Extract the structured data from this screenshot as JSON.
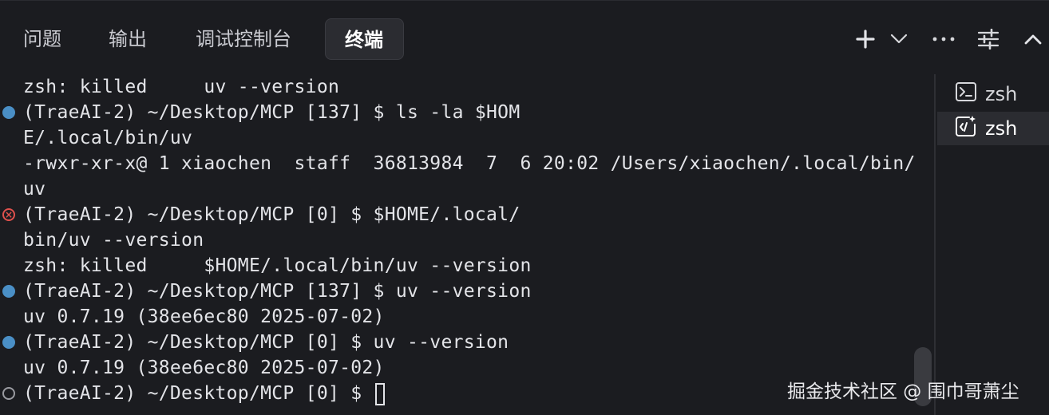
{
  "tabs": [
    {
      "label": "问题"
    },
    {
      "label": "输出"
    },
    {
      "label": "调试控制台"
    },
    {
      "label": "终端",
      "active": true
    }
  ],
  "toolbar": {
    "icons": [
      "plus-icon",
      "chevron-down-icon",
      "more-icon",
      "sliders-icon",
      "chevron-up-icon"
    ]
  },
  "terminal": {
    "lines": [
      {
        "text": "zsh: killed     uv --version",
        "marker": ""
      },
      {
        "text": "(TraeAI-2) ~/Desktop/MCP [137] $ ls -la $HOM",
        "marker": "ok"
      },
      {
        "text": "E/.local/bin/uv",
        "marker": ""
      },
      {
        "text": "-rwxr-xr-x@ 1 xiaochen  staff  36813984  7  6 20:02 /Users/xiaochen/.local/bin/",
        "marker": ""
      },
      {
        "text": "uv",
        "marker": ""
      },
      {
        "text": "(TraeAI-2) ~/Desktop/MCP [0] $ $HOME/.local/",
        "marker": "err"
      },
      {
        "text": "bin/uv --version",
        "marker": ""
      },
      {
        "text": "zsh: killed     $HOME/.local/bin/uv --version",
        "marker": ""
      },
      {
        "text": "(TraeAI-2) ~/Desktop/MCP [137] $ uv --version",
        "marker": "ok"
      },
      {
        "text": "uv 0.7.19 (38ee6ec80 2025-07-02)",
        "marker": ""
      },
      {
        "text": "(TraeAI-2) ~/Desktop/MCP [0] $ uv --version",
        "marker": "ok"
      },
      {
        "text": "uv 0.7.19 (38ee6ec80 2025-07-02)",
        "marker": ""
      },
      {
        "text": "(TraeAI-2) ~/Desktop/MCP [0] $ ",
        "marker": "pending"
      }
    ]
  },
  "sessions": [
    {
      "label": "zsh",
      "icon": "terminal-icon"
    },
    {
      "label": "zsh",
      "icon": "ai-terminal-icon",
      "active": true
    }
  ],
  "watermark": "掘金技术社区 @ 围巾哥萧尘",
  "colors": {
    "background": "#1b1c20",
    "active_tab": "#2b2c31",
    "marker_ok": "#4a8fc6",
    "marker_error": "#e0514d"
  }
}
